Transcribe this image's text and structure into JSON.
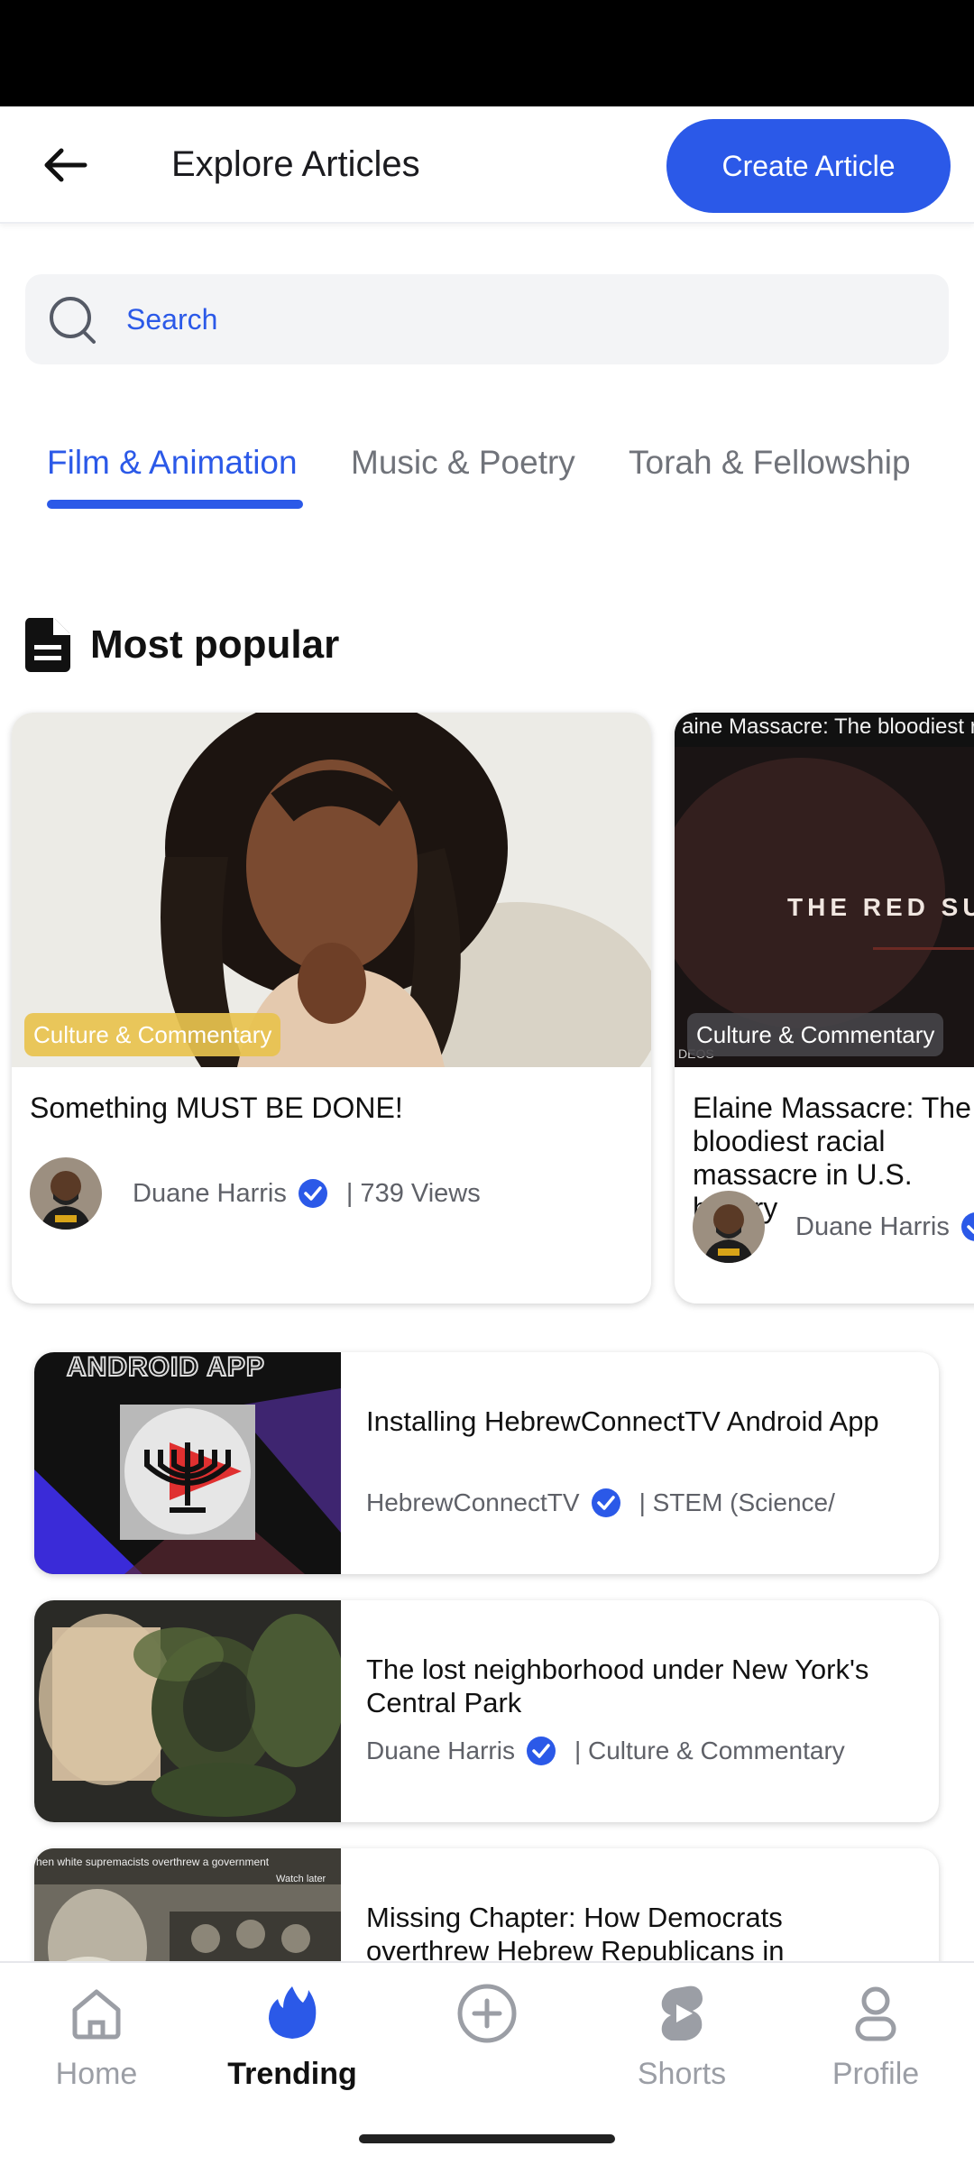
{
  "header": {
    "title": "Explore Articles",
    "create_label": "Create Article"
  },
  "search": {
    "placeholder": "Search"
  },
  "tabs": [
    {
      "label": "Film & Animation",
      "active": true
    },
    {
      "label": "Music & Poetry",
      "active": false
    },
    {
      "label": "Torah & Fellowship",
      "active": false
    }
  ],
  "section": {
    "title": "Most popular",
    "icon": "document-icon"
  },
  "popular": [
    {
      "category": "Culture & Commentary",
      "title": "Something MUST BE DONE!",
      "author": "Duane Harris",
      "views": "| 739 Views",
      "thumb_text": "",
      "thumb_caption": ""
    },
    {
      "category": "Culture & Commentary",
      "title": "Elaine Massacre: The bloodiest racial massacre in U.S. history",
      "author": "Duane Harris",
      "views": "",
      "thumb_text": "aine Massacre: The bloodiest r",
      "thumb_caption": "THE RED SU",
      "thumb_small": "DEOS"
    }
  ],
  "articles": [
    {
      "title": "Installing HebrewConnectTV Android App",
      "author": "HebrewConnectTV",
      "category": "| STEM (Science/",
      "thumb_text": "ANDROID APP"
    },
    {
      "title": "The lost neighborhood under New York's Central Park",
      "author": "Duane Harris",
      "category": "| Culture & Commentary",
      "thumb_text": ""
    },
    {
      "title": "Missing Chapter: How Democrats overthrew Hebrew Republicans in",
      "author": "",
      "category": "",
      "thumb_text": "hen white supremacists overthrew a government",
      "thumb_small": "Watch later"
    }
  ],
  "bottom_nav": [
    {
      "label": "Home",
      "icon": "home-icon",
      "active": false
    },
    {
      "label": "Trending",
      "icon": "flame-icon",
      "active": true
    },
    {
      "label": "",
      "icon": "add-circle-icon",
      "active": false
    },
    {
      "label": "Shorts",
      "icon": "shorts-icon",
      "active": false
    },
    {
      "label": "Profile",
      "icon": "person-icon",
      "active": false
    }
  ],
  "colors": {
    "accent": "#2b59e8",
    "badge_gold": "#e8c24e",
    "badge_dark": "#3a3a3c",
    "text_muted": "#5f6168"
  }
}
